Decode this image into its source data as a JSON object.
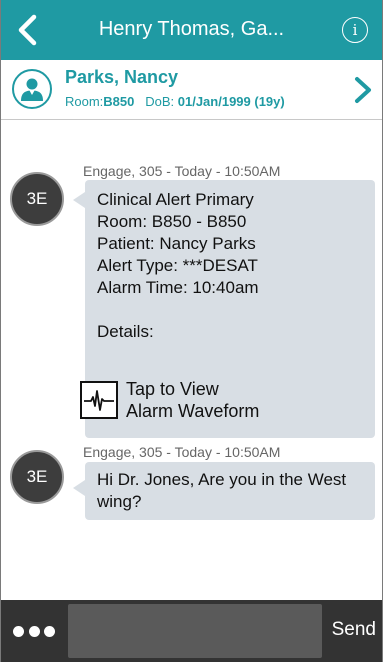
{
  "topbar": {
    "title": "Henry Thomas, Ga...",
    "back_icon": "back-chevron-icon",
    "info_icon": "info-icon",
    "info_glyph": "i",
    "color": "#1f9aa3"
  },
  "patient": {
    "name": "Parks, Nancy",
    "room_label": "Room:",
    "room": "B850",
    "dob_label": "DoB:",
    "dob": "01/Jan/1999 (19y)",
    "avatar_icon": "patient-avatar-icon",
    "chevron_icon": "chevron-right-icon"
  },
  "messages": [
    {
      "meta": "Engage, 305 - Today - 10:50AM",
      "sender_initials": "3E",
      "lines": [
        "Clinical Alert Primary",
        "Room: B850 - B850",
        "Patient: Nancy Parks",
        "Alert Type: ***DESAT",
        "Alarm Time: 10:40am",
        "",
        "Details:"
      ],
      "link": {
        "line1": "Tap to View",
        "line2": "Alarm Waveform",
        "icon": "waveform-icon"
      }
    },
    {
      "meta": "Engage, 305 - Today - 10:50AM",
      "sender_initials": "3E",
      "lines": [
        "Hi Dr. Jones, Are you in the West",
        "wing?"
      ]
    }
  ],
  "composer": {
    "more_icon": "more-dots-icon",
    "input_value": "",
    "input_placeholder": "",
    "send_label": "Send"
  }
}
